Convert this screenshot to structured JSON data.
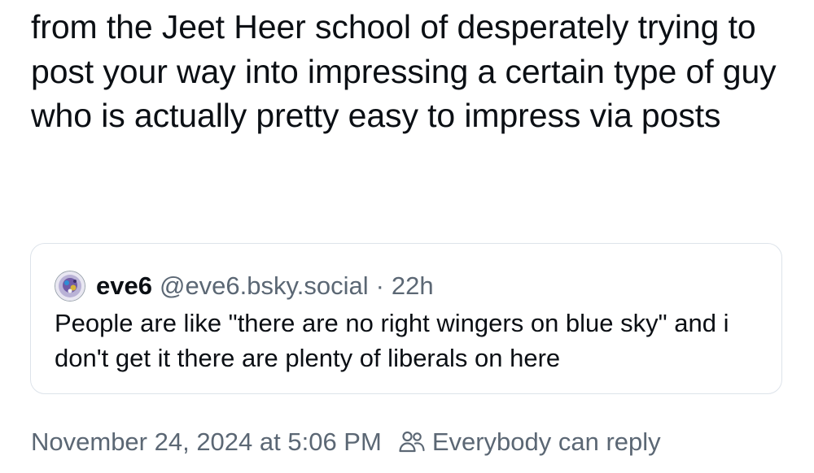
{
  "post": {
    "text": "from the Jeet Heer school of desperately trying to post your way into impressing a certain type of guy who is actually pretty easy to impress via posts"
  },
  "quote": {
    "avatar_icon": "avatar-image",
    "display_name": "eve6",
    "handle": "@eve6.bsky.social",
    "separator": "·",
    "age": "22h",
    "text": "People are like \"there are no right wingers on blue sky\" and i don't get it there are plenty of liberals on here"
  },
  "footer": {
    "timestamp": "November 24, 2024 at 5:06 PM",
    "reply_icon": "people-icon",
    "reply_setting": "Everybody can reply"
  },
  "colors": {
    "text": "#0b0f14",
    "muted": "#5b6774",
    "border": "#dde3ea"
  }
}
